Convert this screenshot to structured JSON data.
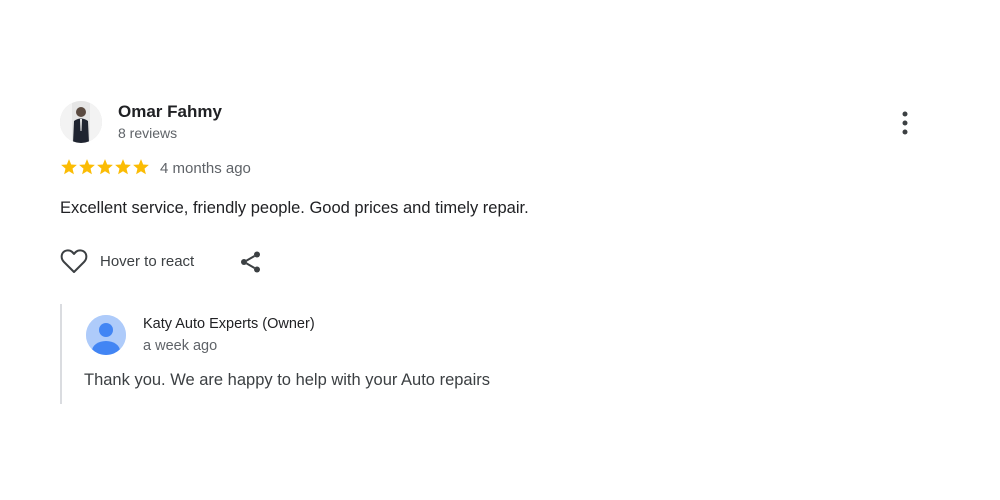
{
  "review": {
    "author": "Omar Fahmy",
    "review_count": "8 reviews",
    "rating": 5,
    "date": "4 months ago",
    "text": "Excellent service, friendly people. Good prices and timely repair.",
    "react_label": "Hover to react",
    "star_color": "#fbbc04"
  },
  "reply": {
    "author": "Katy Auto Experts (Owner)",
    "date": "a week ago",
    "text": "Thank you. We are happy to help with your Auto repairs",
    "avatar_color": "#4285f4"
  },
  "icons": {
    "more": "more-vert-icon",
    "react": "heart-outline-icon",
    "share": "share-icon",
    "star": "star-icon"
  }
}
